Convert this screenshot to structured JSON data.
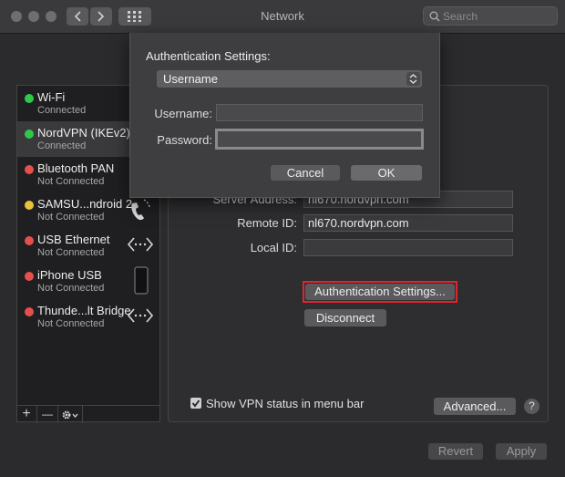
{
  "window": {
    "title": "Network"
  },
  "search": {
    "placeholder": "Search"
  },
  "services": [
    {
      "name": "Wi-Fi",
      "status": "Connected",
      "dot": "#2fc84a"
    },
    {
      "name": "NordVPN (IKEv2)",
      "status": "Connected",
      "dot": "#2fc84a"
    },
    {
      "name": "Bluetooth PAN",
      "status": "Not Connected",
      "dot": "#e5504c"
    },
    {
      "name": "SAMSU...ndroid 2",
      "status": "Not Connected",
      "dot": "#e8c23a"
    },
    {
      "name": "USB Ethernet",
      "status": "Not Connected",
      "dot": "#e5504c"
    },
    {
      "name": "iPhone USB",
      "status": "Not Connected",
      "dot": "#e5504c"
    },
    {
      "name": "Thunde...lt Bridge",
      "status": "Not Connected",
      "dot": "#e5504c"
    }
  ],
  "sidebar_toolbar": {
    "add": "+",
    "remove": "—"
  },
  "detail": {
    "server_address_label": "Server Address:",
    "server_address_value": "nl670.nordvpn.com",
    "remote_id_label": "Remote ID:",
    "remote_id_value": "nl670.nordvpn.com",
    "local_id_label": "Local ID:",
    "local_id_value": "",
    "auth_settings_button": "Authentication Settings...",
    "disconnect_button": "Disconnect",
    "show_vpn_status": "Show VPN status in menu bar",
    "advanced_button": "Advanced...",
    "help": "?"
  },
  "footer": {
    "revert": "Revert",
    "apply": "Apply"
  },
  "sheet": {
    "title": "Authentication Settings:",
    "method": "Username",
    "username_label": "Username:",
    "username_value": "",
    "password_label": "Password:",
    "password_value": "",
    "cancel": "Cancel",
    "ok": "OK"
  },
  "colors": {
    "highlight": "#e0242b",
    "connected": "#2fc84a",
    "not_connected": "#e5504c",
    "warning": "#e8c23a"
  }
}
